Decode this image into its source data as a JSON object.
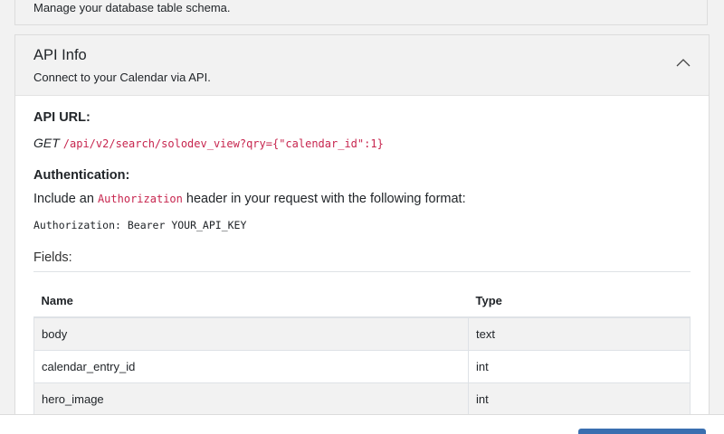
{
  "previous_card": {
    "description": "Manage your database table schema."
  },
  "api_card": {
    "title": "API Info",
    "subtitle": "Connect to your Calendar via API.",
    "collapse_icon": "chevron-up-icon",
    "api_url": {
      "label": "API URL:",
      "method": "GET",
      "endpoint": "/api/v2/search/solodev_view?qry={\"calendar_id\":1}"
    },
    "authentication": {
      "label": "Authentication:",
      "text_before": "Include an ",
      "header_name": "Authorization",
      "text_after": " header in your request with the following format:",
      "format": "Authorization: Bearer YOUR_API_KEY"
    },
    "fields": {
      "label": "Fields:",
      "columns": [
        "Name",
        "Type"
      ],
      "rows": [
        {
          "name": "body",
          "type": "text"
        },
        {
          "name": "calendar_entry_id",
          "type": "int"
        },
        {
          "name": "hero_image",
          "type": "int"
        }
      ]
    }
  },
  "colors": {
    "code": "#c7254e",
    "header_bg": "#f2f2f2",
    "primary_button": "#3a6fb0"
  }
}
